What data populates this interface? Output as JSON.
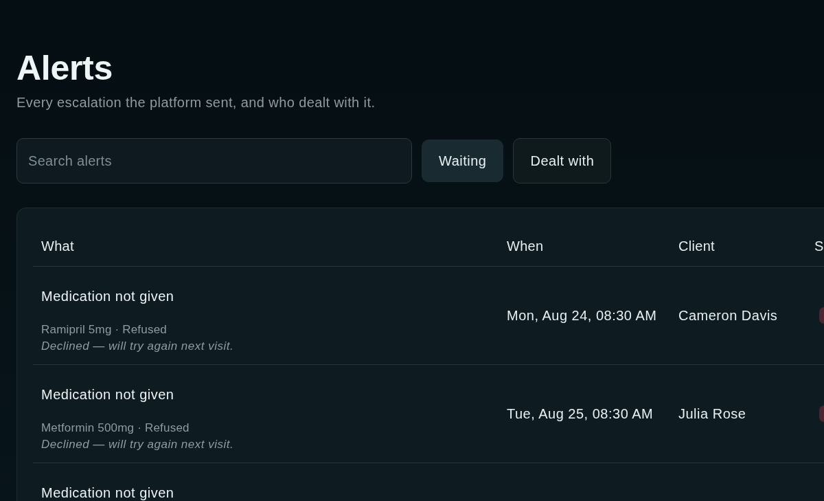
{
  "page": {
    "title": "Alerts",
    "subtitle": "Every escalation the platform sent, and who dealt with it."
  },
  "search": {
    "placeholder": "Search alerts"
  },
  "filters": [
    {
      "label": "Waiting",
      "selected": true
    },
    {
      "label": "Dealt with",
      "selected": false
    }
  ],
  "table": {
    "columns": [
      "What",
      "When",
      "Client",
      "S"
    ],
    "rows": [
      {
        "title": "Medication not given",
        "detail": "Ramipril 5mg · Refused",
        "note": "Declined — will try again next visit.",
        "when": "Mon, Aug 24, 08:30 AM",
        "client": "Cameron Davis"
      },
      {
        "title": "Medication not given",
        "detail": "Metformin 500mg · Refused",
        "note": "Declined — will try again next visit.",
        "when": "Tue, Aug 25, 08:30 AM",
        "client": "Julia Rose"
      },
      {
        "title": "Medication not given"
      }
    ]
  }
}
